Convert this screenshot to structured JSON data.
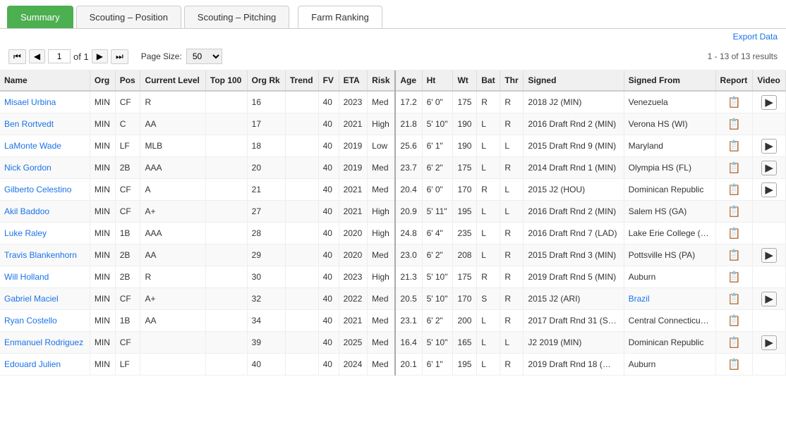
{
  "tabs": [
    {
      "label": "Summary",
      "active": true
    },
    {
      "label": "Scouting – Position",
      "active": false
    },
    {
      "label": "Scouting – Pitching",
      "active": false
    },
    {
      "label": "Farm Ranking",
      "active": false,
      "farm": true
    }
  ],
  "export": "Export Data",
  "pagination": {
    "current_page": "1",
    "of_label": "of 1",
    "page_size_label": "Page Size:",
    "page_size": "50",
    "results_label": "1 - 13 of 13 results"
  },
  "columns": [
    "Name",
    "Org",
    "Pos",
    "Current Level",
    "Top 100",
    "Org Rk",
    "Trend",
    "FV",
    "ETA",
    "Risk",
    "Age",
    "Ht",
    "Wt",
    "Bat",
    "Thr",
    "Signed",
    "Signed From",
    "Report",
    "Video"
  ],
  "rows": [
    {
      "name": "Misael Urbina",
      "org": "MIN",
      "pos": "CF",
      "level": "R",
      "top100": "",
      "org_rk": "16",
      "trend": "",
      "fv": "40",
      "eta": "2023",
      "risk": "Med",
      "age": "17.2",
      "ht": "6' 0\"",
      "wt": "175",
      "bat": "R",
      "thr": "R",
      "signed": "2018 J2 (MIN)",
      "signed_from": "Venezuela",
      "report": true,
      "video": true
    },
    {
      "name": "Ben Rortvedt",
      "org": "MIN",
      "pos": "C",
      "level": "AA",
      "top100": "",
      "org_rk": "17",
      "trend": "",
      "fv": "40",
      "eta": "2021",
      "risk": "High",
      "age": "21.8",
      "ht": "5' 10\"",
      "wt": "190",
      "bat": "L",
      "thr": "R",
      "signed": "2016 Draft Rnd 2 (MIN)",
      "signed_from": "Verona HS (WI)",
      "report": true,
      "video": false
    },
    {
      "name": "LaMonte Wade",
      "org": "MIN",
      "pos": "LF",
      "level": "MLB",
      "top100": "",
      "org_rk": "18",
      "trend": "",
      "fv": "40",
      "eta": "2019",
      "risk": "Low",
      "age": "25.6",
      "ht": "6' 1\"",
      "wt": "190",
      "bat": "L",
      "thr": "L",
      "signed": "2015 Draft Rnd 9 (MIN)",
      "signed_from": "Maryland",
      "report": true,
      "video": true
    },
    {
      "name": "Nick Gordon",
      "org": "MIN",
      "pos": "2B",
      "level": "AAA",
      "top100": "",
      "org_rk": "20",
      "trend": "",
      "fv": "40",
      "eta": "2019",
      "risk": "Med",
      "age": "23.7",
      "ht": "6' 2\"",
      "wt": "175",
      "bat": "L",
      "thr": "R",
      "signed": "2014 Draft Rnd 1 (MIN)",
      "signed_from": "Olympia HS (FL)",
      "report": true,
      "video": true
    },
    {
      "name": "Gilberto Celestino",
      "org": "MIN",
      "pos": "CF",
      "level": "A",
      "top100": "",
      "org_rk": "21",
      "trend": "",
      "fv": "40",
      "eta": "2021",
      "risk": "Med",
      "age": "20.4",
      "ht": "6' 0\"",
      "wt": "170",
      "bat": "R",
      "thr": "L",
      "signed": "2015 J2 (HOU)",
      "signed_from": "Dominican Republic",
      "report": true,
      "video": true
    },
    {
      "name": "Akil Baddoo",
      "org": "MIN",
      "pos": "CF",
      "level": "A+",
      "top100": "",
      "org_rk": "27",
      "trend": "",
      "fv": "40",
      "eta": "2021",
      "risk": "High",
      "age": "20.9",
      "ht": "5' 11\"",
      "wt": "195",
      "bat": "L",
      "thr": "L",
      "signed": "2016 Draft Rnd 2 (MIN)",
      "signed_from": "Salem HS (GA)",
      "report": true,
      "video": false
    },
    {
      "name": "Luke Raley",
      "org": "MIN",
      "pos": "1B",
      "level": "AAA",
      "top100": "",
      "org_rk": "28",
      "trend": "",
      "fv": "40",
      "eta": "2020",
      "risk": "High",
      "age": "24.8",
      "ht": "6' 4\"",
      "wt": "235",
      "bat": "L",
      "thr": "R",
      "signed": "2016 Draft Rnd 7 (LAD)",
      "signed_from": "Lake Erie College (…",
      "report": true,
      "video": false
    },
    {
      "name": "Travis Blankenhorn",
      "org": "MIN",
      "pos": "2B",
      "level": "AA",
      "top100": "",
      "org_rk": "29",
      "trend": "",
      "fv": "40",
      "eta": "2020",
      "risk": "Med",
      "age": "23.0",
      "ht": "6' 2\"",
      "wt": "208",
      "bat": "L",
      "thr": "R",
      "signed": "2015 Draft Rnd 3 (MIN)",
      "signed_from": "Pottsville HS (PA)",
      "report": true,
      "video": true
    },
    {
      "name": "Will Holland",
      "org": "MIN",
      "pos": "2B",
      "level": "R",
      "top100": "",
      "org_rk": "30",
      "trend": "",
      "fv": "40",
      "eta": "2023",
      "risk": "High",
      "age": "21.3",
      "ht": "5' 10\"",
      "wt": "175",
      "bat": "R",
      "thr": "R",
      "signed": "2019 Draft Rnd 5 (MIN)",
      "signed_from": "Auburn",
      "report": true,
      "video": false
    },
    {
      "name": "Gabriel Maciel",
      "org": "MIN",
      "pos": "CF",
      "level": "A+",
      "top100": "",
      "org_rk": "32",
      "trend": "",
      "fv": "40",
      "eta": "2022",
      "risk": "Med",
      "age": "20.5",
      "ht": "5' 10\"",
      "wt": "170",
      "bat": "S",
      "thr": "R",
      "signed": "2015 J2 (ARI)",
      "signed_from": "Brazil",
      "report": true,
      "video": true
    },
    {
      "name": "Ryan Costello",
      "org": "MIN",
      "pos": "1B",
      "level": "AA",
      "top100": "",
      "org_rk": "34",
      "trend": "",
      "fv": "40",
      "eta": "2021",
      "risk": "Med",
      "age": "23.1",
      "ht": "6' 2\"",
      "wt": "200",
      "bat": "L",
      "thr": "R",
      "signed": "2017 Draft Rnd 31 (S…",
      "signed_from": "Central Connecticu…",
      "report": true,
      "video": false
    },
    {
      "name": "Enmanuel Rodriguez",
      "org": "MIN",
      "pos": "CF",
      "level": "",
      "top100": "",
      "org_rk": "39",
      "trend": "",
      "fv": "40",
      "eta": "2025",
      "risk": "Med",
      "age": "16.4",
      "ht": "5' 10\"",
      "wt": "165",
      "bat": "L",
      "thr": "L",
      "signed": "J2 2019 (MIN)",
      "signed_from": "Dominican Republic",
      "report": true,
      "video": true
    },
    {
      "name": "Edouard Julien",
      "org": "MIN",
      "pos": "LF",
      "level": "",
      "top100": "",
      "org_rk": "40",
      "trend": "",
      "fv": "40",
      "eta": "2024",
      "risk": "Med",
      "age": "20.1",
      "ht": "6' 1\"",
      "wt": "195",
      "bat": "L",
      "thr": "R",
      "signed": "2019 Draft Rnd 18 (…",
      "signed_from": "Auburn",
      "report": true,
      "video": false
    }
  ],
  "icons": {
    "first": "⏮",
    "prev": "◀",
    "next": "▶",
    "last": "⏭",
    "report": "📋",
    "video": "▶"
  }
}
